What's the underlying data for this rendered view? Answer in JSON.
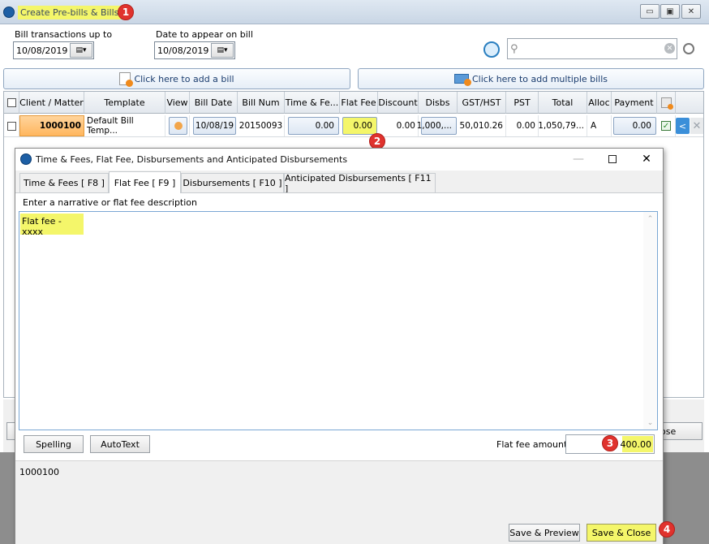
{
  "main_window": {
    "title": "Create Pre-bills & Bills",
    "bill_transactions_label": "Bill transactions up to",
    "bill_transactions_value": "10/08/2019",
    "date_on_bill_label": "Date to appear on bill",
    "date_on_bill_value": "10/08/2019",
    "add_bill_label": "Click here to add a bill",
    "add_multiple_label": "Click here to add multiple bills"
  },
  "grid": {
    "headers": [
      "Client / Matter",
      "Template",
      "View",
      "Bill Date",
      "Bill Num",
      "Time & Fe...",
      "Flat Fee",
      "Discount",
      "Disbs",
      "GST/HST",
      "PST",
      "Total",
      "Alloc",
      "Payment"
    ],
    "row": {
      "client_matter": "1000100",
      "template": "Default Bill Temp...",
      "bill_date": "10/08/19",
      "bill_num": "20150093",
      "time_fees": "0.00",
      "flat_fee": "0.00",
      "discount": "0.00",
      "disbs": "1,000,...",
      "gst_hst": "50,010.26",
      "pst": "0.00",
      "total": "1,050,79...",
      "alloc": "A",
      "payment": "0.00"
    }
  },
  "dialog": {
    "title": "Time & Fees, Flat Fee, Disbursements and Anticipated Disbursements",
    "tabs": [
      "Time & Fees [ F8 ]",
      "Flat Fee [ F9 ]",
      "Disbursements [ F10 ]",
      "Anticipated Disbursements [ F11 ]"
    ],
    "narrative_label": "Enter a narrative or flat fee description",
    "narrative_text": "Flat fee - xxxx",
    "spelling_label": "Spelling",
    "autotext_label": "AutoText",
    "flat_fee_amount_label": "Flat fee amount",
    "flat_fee_amount_value": "400.00",
    "matter_label": "1000100",
    "save_preview_label": "Save & Preview",
    "save_close_label": "Save & Close"
  },
  "background": {
    "partial_button_label": "ose"
  },
  "callouts": [
    "1",
    "2",
    "3",
    "4"
  ],
  "colors": {
    "highlight": "#f4f66a",
    "callout": "#e0322d",
    "client_cell": "#ffc47a"
  }
}
